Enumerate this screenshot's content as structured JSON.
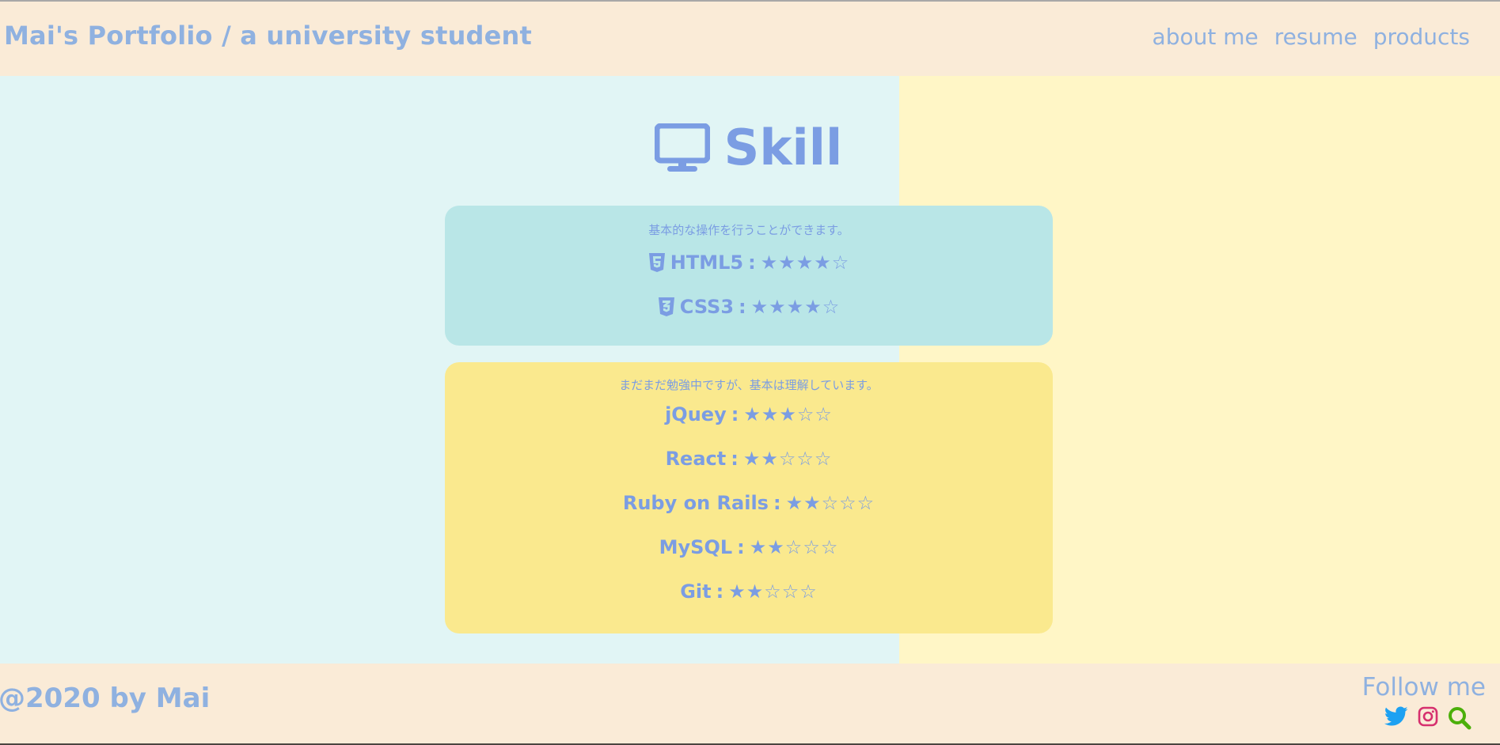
{
  "header": {
    "title": "Mai's Portfolio / a university student",
    "nav": [
      {
        "label": "about me"
      },
      {
        "label": "resume"
      },
      {
        "label": "products"
      }
    ]
  },
  "section": {
    "icon": "desktop-monitor-icon",
    "title": "Skill"
  },
  "cards": [
    {
      "description": "基本的な操作を行うことができます。",
      "skills": [
        {
          "icon": "html5-icon",
          "name": "HTML5",
          "separator": " : ",
          "rating": 4,
          "max": 5,
          "stars": "★★★★☆"
        },
        {
          "icon": "css3-icon",
          "name": "CSS3",
          "separator": " : ",
          "rating": 4,
          "max": 5,
          "stars": "★★★★☆"
        }
      ]
    },
    {
      "description": "まだまだ勉強中ですが、基本は理解しています。",
      "skills": [
        {
          "name": "jQuey",
          "separator": " : ",
          "rating": 3,
          "max": 5,
          "stars": "★★★☆☆"
        },
        {
          "name": "React",
          "separator": " : ",
          "rating": 2,
          "max": 5,
          "stars": "★★☆☆☆"
        },
        {
          "name": "Ruby on Rails",
          "separator": " : ",
          "rating": 2,
          "max": 5,
          "stars": "★★☆☆☆"
        },
        {
          "name": "MySQL",
          "separator": " : ",
          "rating": 2,
          "max": 5,
          "stars": "★★☆☆☆"
        },
        {
          "name": "Git",
          "separator": " : ",
          "rating": 2,
          "max": 5,
          "stars": "★★☆☆☆"
        }
      ]
    }
  ],
  "footer": {
    "copyright": "@2020 by Mai",
    "follow_label": "Follow me",
    "social": [
      {
        "icon": "twitter-icon",
        "color": "#1da1f2"
      },
      {
        "icon": "instagram-icon",
        "color": "#d6306e"
      },
      {
        "icon": "search-icon",
        "color": "#4caf0a"
      }
    ]
  },
  "colors": {
    "accent": "#7b9de3",
    "title_text": "#8fb1e0",
    "header_bg": "#faebd7",
    "left_bg": "#e1f5f5",
    "right_bg": "#fff6c6",
    "basic_card_bg": "#b9e6e7",
    "learning_card_bg": "#fae98e"
  }
}
